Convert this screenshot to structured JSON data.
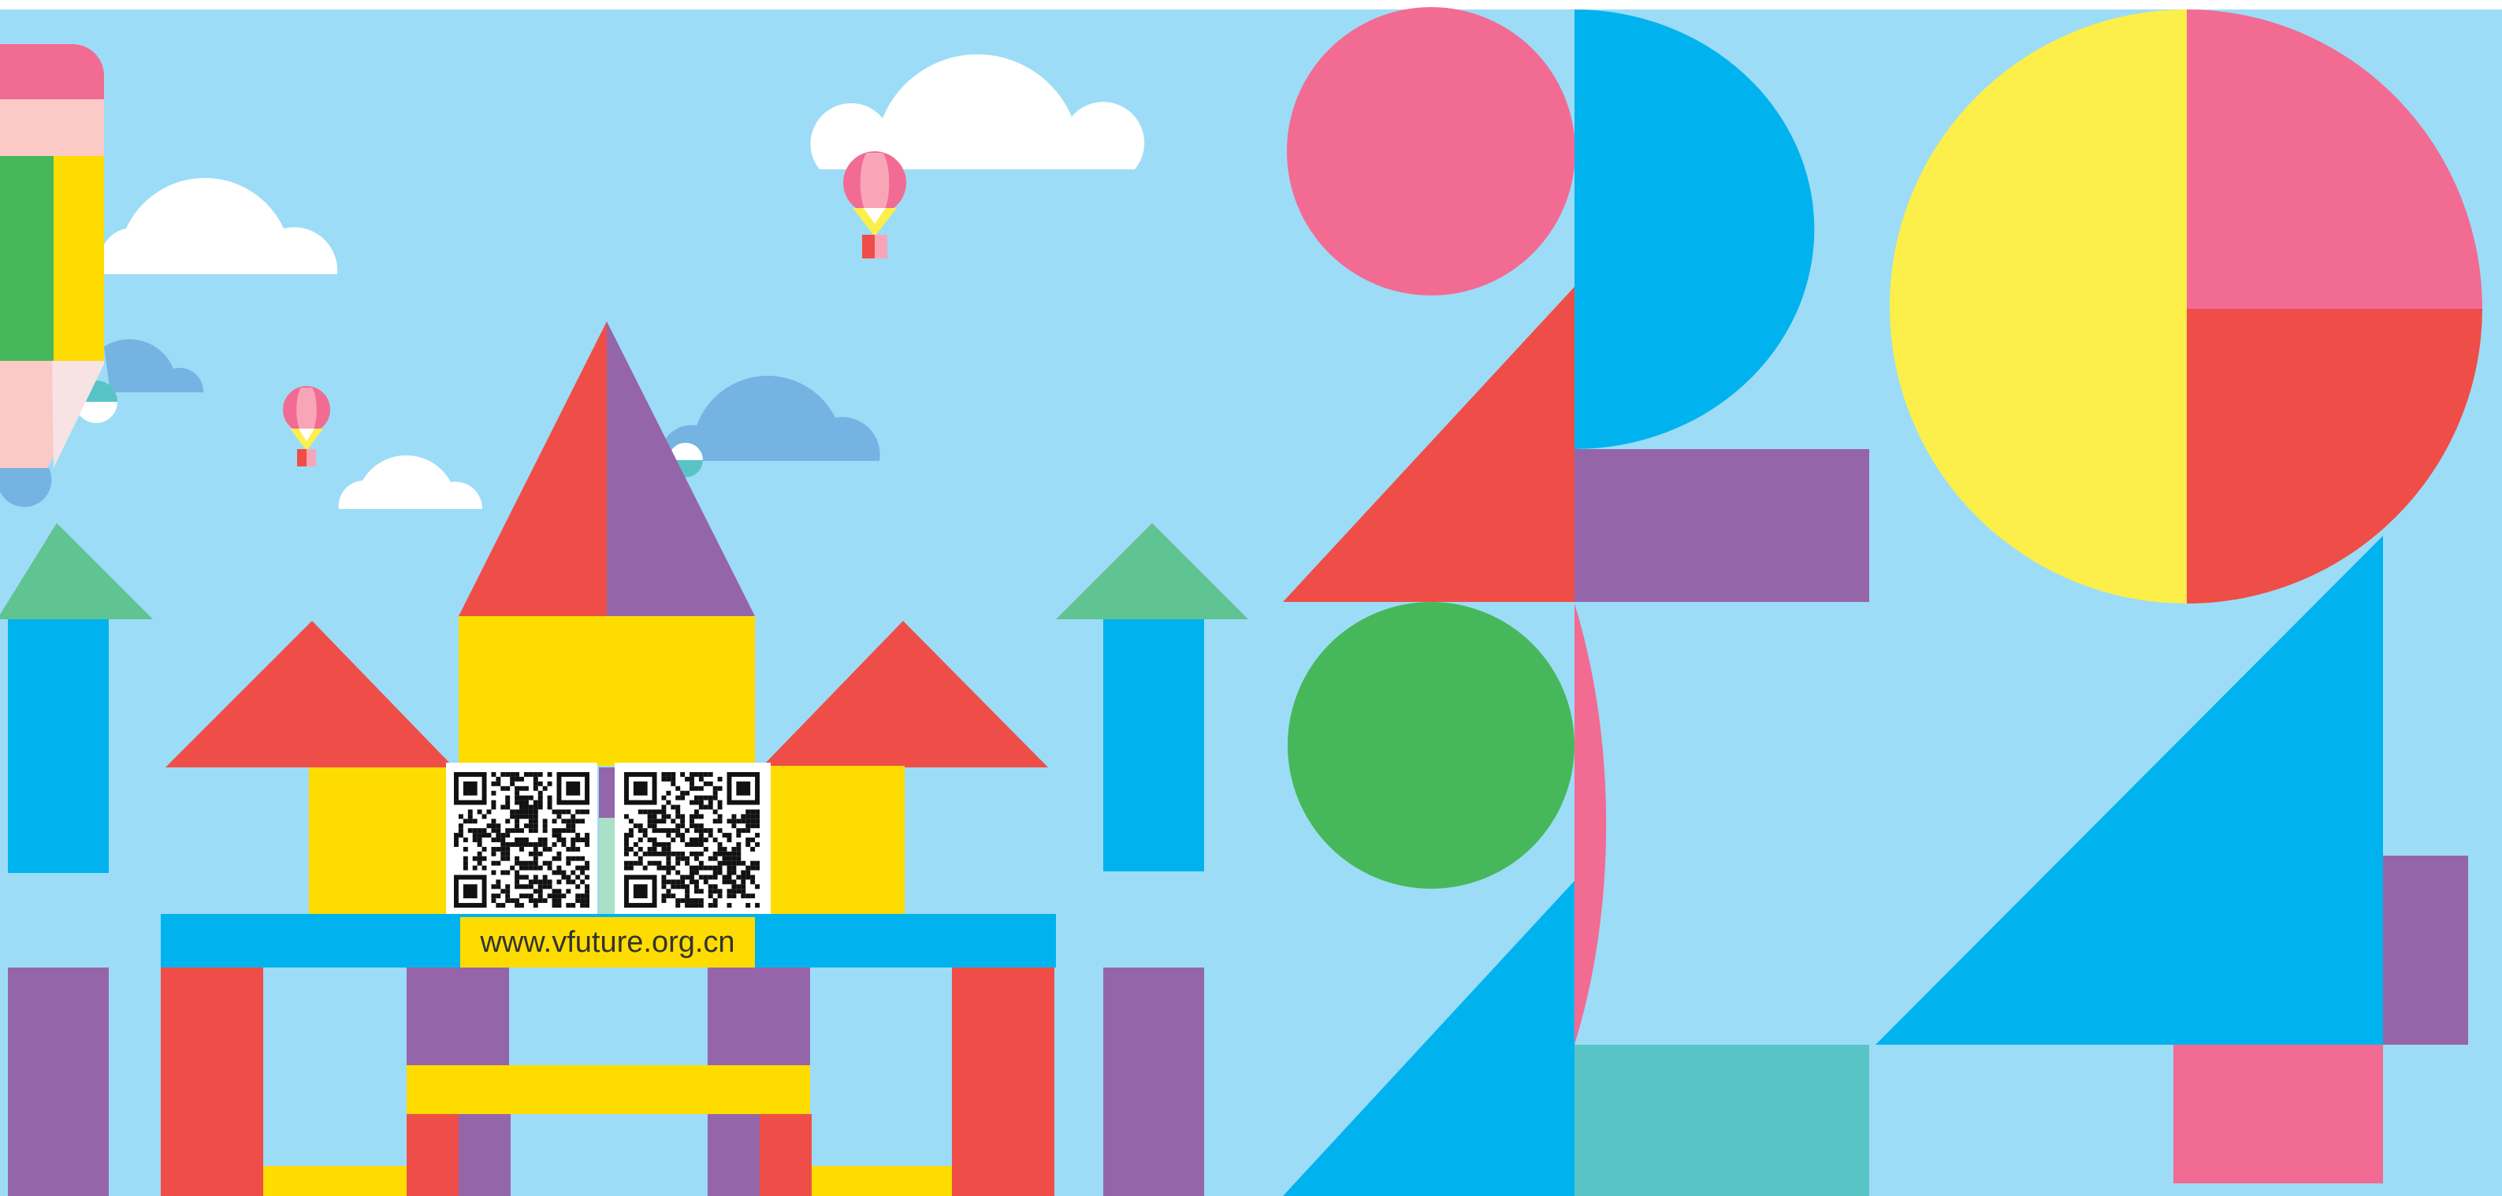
{
  "website": {
    "url": "www.vfuture.org.cn"
  },
  "colors": {
    "sky": "#9ddcf6",
    "pink": "#f26b93",
    "blue": "#00b3ee",
    "red": "#ee4e47",
    "purple": "#9565aa",
    "yellow": "#ffdc00",
    "pale_yellow": "#fcef4a",
    "green": "#46b85b",
    "mint_green": "#5fc392",
    "teal": "#58c4c6",
    "cloud_blue": "#74b3e2",
    "white": "#ffffff"
  },
  "qr_codes": [
    {
      "name": "qr-code-left"
    },
    {
      "name": "qr-code-right"
    }
  ]
}
